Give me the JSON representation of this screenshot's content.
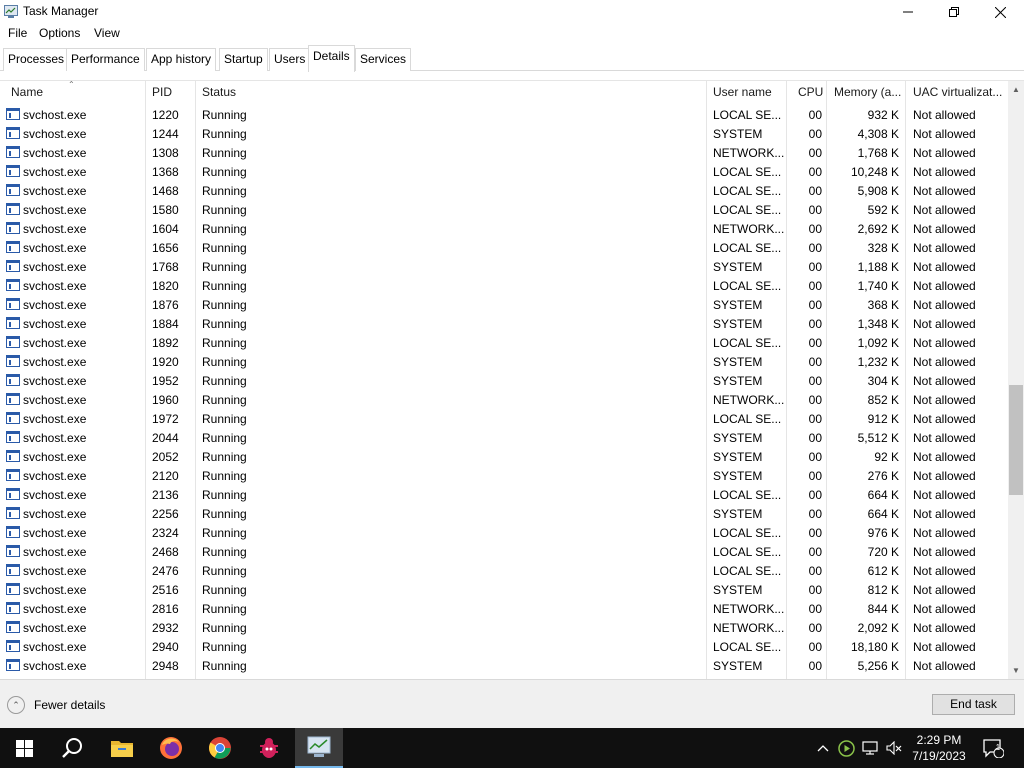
{
  "window": {
    "title": "Task Manager",
    "minimize": "minimize",
    "maximize": "restore",
    "close": "close"
  },
  "menu": [
    "File",
    "Options",
    "View"
  ],
  "tabs": [
    "Processes",
    "Performance",
    "App history",
    "Startup",
    "Users",
    "Details",
    "Services"
  ],
  "active_tab": "Details",
  "columns": {
    "name": "Name",
    "pid": "PID",
    "status": "Status",
    "user": "User name",
    "cpu": "CPU",
    "memory": "Memory (a...",
    "uac": "UAC virtualizat..."
  },
  "processes": [
    {
      "name": "svchost.exe",
      "pid": "1220",
      "status": "Running",
      "user": "LOCAL SE...",
      "cpu": "00",
      "memory": "932 K",
      "uac": "Not allowed"
    },
    {
      "name": "svchost.exe",
      "pid": "1244",
      "status": "Running",
      "user": "SYSTEM",
      "cpu": "00",
      "memory": "4,308 K",
      "uac": "Not allowed"
    },
    {
      "name": "svchost.exe",
      "pid": "1308",
      "status": "Running",
      "user": "NETWORK...",
      "cpu": "00",
      "memory": "1,768 K",
      "uac": "Not allowed"
    },
    {
      "name": "svchost.exe",
      "pid": "1368",
      "status": "Running",
      "user": "LOCAL SE...",
      "cpu": "00",
      "memory": "10,248 K",
      "uac": "Not allowed"
    },
    {
      "name": "svchost.exe",
      "pid": "1468",
      "status": "Running",
      "user": "LOCAL SE...",
      "cpu": "00",
      "memory": "5,908 K",
      "uac": "Not allowed"
    },
    {
      "name": "svchost.exe",
      "pid": "1580",
      "status": "Running",
      "user": "LOCAL SE...",
      "cpu": "00",
      "memory": "592 K",
      "uac": "Not allowed"
    },
    {
      "name": "svchost.exe",
      "pid": "1604",
      "status": "Running",
      "user": "NETWORK...",
      "cpu": "00",
      "memory": "2,692 K",
      "uac": "Not allowed"
    },
    {
      "name": "svchost.exe",
      "pid": "1656",
      "status": "Running",
      "user": "LOCAL SE...",
      "cpu": "00",
      "memory": "328 K",
      "uac": "Not allowed"
    },
    {
      "name": "svchost.exe",
      "pid": "1768",
      "status": "Running",
      "user": "SYSTEM",
      "cpu": "00",
      "memory": "1,188 K",
      "uac": "Not allowed"
    },
    {
      "name": "svchost.exe",
      "pid": "1820",
      "status": "Running",
      "user": "LOCAL SE...",
      "cpu": "00",
      "memory": "1,740 K",
      "uac": "Not allowed"
    },
    {
      "name": "svchost.exe",
      "pid": "1876",
      "status": "Running",
      "user": "SYSTEM",
      "cpu": "00",
      "memory": "368 K",
      "uac": "Not allowed"
    },
    {
      "name": "svchost.exe",
      "pid": "1884",
      "status": "Running",
      "user": "SYSTEM",
      "cpu": "00",
      "memory": "1,348 K",
      "uac": "Not allowed"
    },
    {
      "name": "svchost.exe",
      "pid": "1892",
      "status": "Running",
      "user": "LOCAL SE...",
      "cpu": "00",
      "memory": "1,092 K",
      "uac": "Not allowed"
    },
    {
      "name": "svchost.exe",
      "pid": "1920",
      "status": "Running",
      "user": "SYSTEM",
      "cpu": "00",
      "memory": "1,232 K",
      "uac": "Not allowed"
    },
    {
      "name": "svchost.exe",
      "pid": "1952",
      "status": "Running",
      "user": "SYSTEM",
      "cpu": "00",
      "memory": "304 K",
      "uac": "Not allowed"
    },
    {
      "name": "svchost.exe",
      "pid": "1960",
      "status": "Running",
      "user": "NETWORK...",
      "cpu": "00",
      "memory": "852 K",
      "uac": "Not allowed"
    },
    {
      "name": "svchost.exe",
      "pid": "1972",
      "status": "Running",
      "user": "LOCAL SE...",
      "cpu": "00",
      "memory": "912 K",
      "uac": "Not allowed"
    },
    {
      "name": "svchost.exe",
      "pid": "2044",
      "status": "Running",
      "user": "SYSTEM",
      "cpu": "00",
      "memory": "5,512 K",
      "uac": "Not allowed"
    },
    {
      "name": "svchost.exe",
      "pid": "2052",
      "status": "Running",
      "user": "SYSTEM",
      "cpu": "00",
      "memory": "92 K",
      "uac": "Not allowed"
    },
    {
      "name": "svchost.exe",
      "pid": "2120",
      "status": "Running",
      "user": "SYSTEM",
      "cpu": "00",
      "memory": "276 K",
      "uac": "Not allowed"
    },
    {
      "name": "svchost.exe",
      "pid": "2136",
      "status": "Running",
      "user": "LOCAL SE...",
      "cpu": "00",
      "memory": "664 K",
      "uac": "Not allowed"
    },
    {
      "name": "svchost.exe",
      "pid": "2256",
      "status": "Running",
      "user": "SYSTEM",
      "cpu": "00",
      "memory": "664 K",
      "uac": "Not allowed"
    },
    {
      "name": "svchost.exe",
      "pid": "2324",
      "status": "Running",
      "user": "LOCAL SE...",
      "cpu": "00",
      "memory": "976 K",
      "uac": "Not allowed"
    },
    {
      "name": "svchost.exe",
      "pid": "2468",
      "status": "Running",
      "user": "LOCAL SE...",
      "cpu": "00",
      "memory": "720 K",
      "uac": "Not allowed"
    },
    {
      "name": "svchost.exe",
      "pid": "2476",
      "status": "Running",
      "user": "LOCAL SE...",
      "cpu": "00",
      "memory": "612 K",
      "uac": "Not allowed"
    },
    {
      "name": "svchost.exe",
      "pid": "2516",
      "status": "Running",
      "user": "SYSTEM",
      "cpu": "00",
      "memory": "812 K",
      "uac": "Not allowed"
    },
    {
      "name": "svchost.exe",
      "pid": "2816",
      "status": "Running",
      "user": "NETWORK...",
      "cpu": "00",
      "memory": "844 K",
      "uac": "Not allowed"
    },
    {
      "name": "svchost.exe",
      "pid": "2932",
      "status": "Running",
      "user": "NETWORK...",
      "cpu": "00",
      "memory": "2,092 K",
      "uac": "Not allowed"
    },
    {
      "name": "svchost.exe",
      "pid": "2940",
      "status": "Running",
      "user": "LOCAL SE...",
      "cpu": "00",
      "memory": "18,180 K",
      "uac": "Not allowed"
    },
    {
      "name": "svchost.exe",
      "pid": "2948",
      "status": "Running",
      "user": "SYSTEM",
      "cpu": "00",
      "memory": "5,256 K",
      "uac": "Not allowed"
    }
  ],
  "footer": {
    "fewer_details": "Fewer details",
    "end_task": "End task"
  },
  "taskbar": {
    "apps": [
      "start-icon",
      "search-icon",
      "file-explorer-icon",
      "firefox-icon",
      "chrome-icon",
      "bug-app-icon",
      "task-manager-icon"
    ],
    "clock_time": "2:29 PM",
    "clock_date": "7/19/2023",
    "notification_count": "1"
  },
  "colors": {
    "accent": "#76b9ed",
    "taskbar": "#101010",
    "footer": "#f0f0f0"
  }
}
